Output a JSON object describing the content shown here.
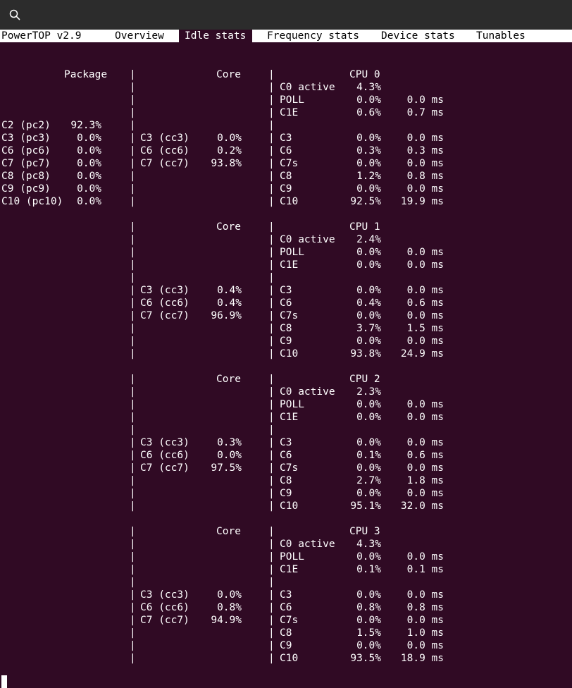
{
  "tabs": [
    {
      "label": "PowerTOP v2.9",
      "selected": false
    },
    {
      "label": "Overview",
      "selected": false
    },
    {
      "label": "Idle stats",
      "selected": true
    },
    {
      "label": "Frequency stats",
      "selected": false
    },
    {
      "label": "Device stats",
      "selected": false
    },
    {
      "label": "Tunables",
      "selected": false
    }
  ],
  "package": {
    "header": "Package",
    "states": [
      {
        "name": "C2 (pc2)",
        "value": "92.3%"
      },
      {
        "name": "C3 (pc3)",
        "value": "0.0%"
      },
      {
        "name": "C6 (pc6)",
        "value": "0.0%"
      },
      {
        "name": "C7 (pc7)",
        "value": "0.0%"
      },
      {
        "name": "C8 (pc8)",
        "value": "0.0%"
      },
      {
        "name": "C9 (pc9)",
        "value": "0.0%"
      },
      {
        "name": "C10 (pc10)",
        "value": "0.0%"
      }
    ]
  },
  "blocks": [
    {
      "core_header": "Core",
      "cpu_header": "CPU 0",
      "core_states": [
        {
          "name": "C3 (cc3)",
          "value": "0.0%"
        },
        {
          "name": "C6 (cc6)",
          "value": "0.2%"
        },
        {
          "name": "C7 (cc7)",
          "value": "93.8%"
        }
      ],
      "cpu_top": [
        {
          "name": "C0 active",
          "pct": "4.3%",
          "time": ""
        },
        {
          "name": "POLL",
          "pct": "0.0%",
          "time": "0.0 ms"
        },
        {
          "name": "C1E",
          "pct": "0.6%",
          "time": "0.7 ms"
        }
      ],
      "cpu_states": [
        {
          "name": "C3",
          "pct": "0.0%",
          "time": "0.0 ms"
        },
        {
          "name": "C6",
          "pct": "0.3%",
          "time": "0.3 ms"
        },
        {
          "name": "C7s",
          "pct": "0.0%",
          "time": "0.0 ms"
        },
        {
          "name": "C8",
          "pct": "1.2%",
          "time": "0.8 ms"
        },
        {
          "name": "C9",
          "pct": "0.0%",
          "time": "0.0 ms"
        },
        {
          "name": "C10",
          "pct": "92.5%",
          "time": "19.9 ms"
        }
      ]
    },
    {
      "core_header": "Core",
      "cpu_header": "CPU 1",
      "core_states": [
        {
          "name": "C3 (cc3)",
          "value": "0.4%"
        },
        {
          "name": "C6 (cc6)",
          "value": "0.4%"
        },
        {
          "name": "C7 (cc7)",
          "value": "96.9%"
        }
      ],
      "cpu_top": [
        {
          "name": "C0 active",
          "pct": "2.4%",
          "time": ""
        },
        {
          "name": "POLL",
          "pct": "0.0%",
          "time": "0.0 ms"
        },
        {
          "name": "C1E",
          "pct": "0.0%",
          "time": "0.0 ms"
        }
      ],
      "cpu_states": [
        {
          "name": "C3",
          "pct": "0.0%",
          "time": "0.0 ms"
        },
        {
          "name": "C6",
          "pct": "0.4%",
          "time": "0.6 ms"
        },
        {
          "name": "C7s",
          "pct": "0.0%",
          "time": "0.0 ms"
        },
        {
          "name": "C8",
          "pct": "3.7%",
          "time": "1.5 ms"
        },
        {
          "name": "C9",
          "pct": "0.0%",
          "time": "0.0 ms"
        },
        {
          "name": "C10",
          "pct": "93.8%",
          "time": "24.9 ms"
        }
      ]
    },
    {
      "core_header": "Core",
      "cpu_header": "CPU 2",
      "core_states": [
        {
          "name": "C3 (cc3)",
          "value": "0.3%"
        },
        {
          "name": "C6 (cc6)",
          "value": "0.0%"
        },
        {
          "name": "C7 (cc7)",
          "value": "97.5%"
        }
      ],
      "cpu_top": [
        {
          "name": "C0 active",
          "pct": "2.3%",
          "time": ""
        },
        {
          "name": "POLL",
          "pct": "0.0%",
          "time": "0.0 ms"
        },
        {
          "name": "C1E",
          "pct": "0.0%",
          "time": "0.0 ms"
        }
      ],
      "cpu_states": [
        {
          "name": "C3",
          "pct": "0.0%",
          "time": "0.0 ms"
        },
        {
          "name": "C6",
          "pct": "0.1%",
          "time": "0.6 ms"
        },
        {
          "name": "C7s",
          "pct": "0.0%",
          "time": "0.0 ms"
        },
        {
          "name": "C8",
          "pct": "2.7%",
          "time": "1.8 ms"
        },
        {
          "name": "C9",
          "pct": "0.0%",
          "time": "0.0 ms"
        },
        {
          "name": "C10",
          "pct": "95.1%",
          "time": "32.0 ms"
        }
      ]
    },
    {
      "core_header": "Core",
      "cpu_header": "CPU 3",
      "core_states": [
        {
          "name": "C3 (cc3)",
          "value": "0.0%"
        },
        {
          "name": "C6 (cc6)",
          "value": "0.8%"
        },
        {
          "name": "C7 (cc7)",
          "value": "94.9%"
        }
      ],
      "cpu_top": [
        {
          "name": "C0 active",
          "pct": "4.3%",
          "time": ""
        },
        {
          "name": "POLL",
          "pct": "0.0%",
          "time": "0.0 ms"
        },
        {
          "name": "C1E",
          "pct": "0.1%",
          "time": "0.1 ms"
        }
      ],
      "cpu_states": [
        {
          "name": "C3",
          "pct": "0.0%",
          "time": "0.0 ms"
        },
        {
          "name": "C6",
          "pct": "0.8%",
          "time": "0.8 ms"
        },
        {
          "name": "C7s",
          "pct": "0.0%",
          "time": "0.0 ms"
        },
        {
          "name": "C8",
          "pct": "1.5%",
          "time": "1.0 ms"
        },
        {
          "name": "C9",
          "pct": "0.0%",
          "time": "0.0 ms"
        },
        {
          "name": "C10",
          "pct": "93.5%",
          "time": "18.9 ms"
        }
      ]
    }
  ],
  "separator": "|",
  "icons": {
    "search": "search-icon"
  },
  "colors": {
    "terminal_bg": "#300a24",
    "titlebar_bg": "#2c2c2c",
    "tabbar_bg": "#ffffff"
  }
}
